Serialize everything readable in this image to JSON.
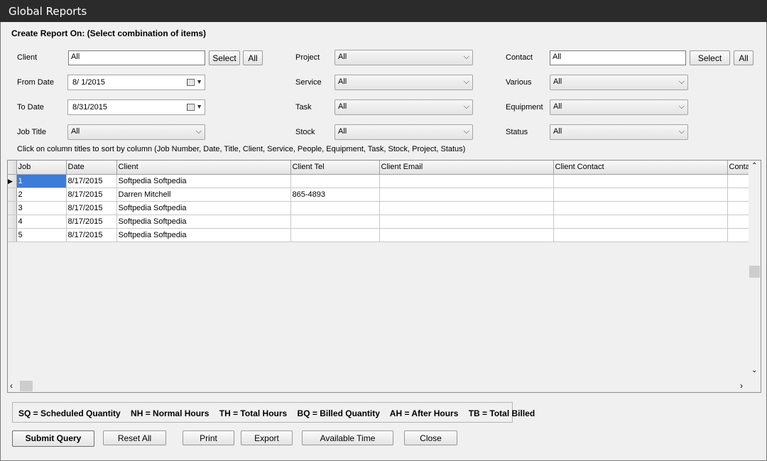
{
  "window": {
    "title": "Global Reports"
  },
  "heading": "Create Report On: (Select combination of items)",
  "filters": {
    "client": {
      "label": "Client",
      "value": "All",
      "select_label": "Select",
      "all_label": "All"
    },
    "from_date": {
      "label": "From Date",
      "value": "8/  1/2015"
    },
    "to_date": {
      "label": "To Date",
      "value": "8/31/2015"
    },
    "job_title": {
      "label": "Job Title",
      "value": "All"
    },
    "project": {
      "label": "Project",
      "value": "All"
    },
    "service": {
      "label": "Service",
      "value": "All"
    },
    "task": {
      "label": "Task",
      "value": "All"
    },
    "stock": {
      "label": "Stock",
      "value": "All"
    },
    "contact": {
      "label": "Contact",
      "value": "All",
      "select_label": "Select",
      "all_label": "All"
    },
    "various": {
      "label": "Various",
      "value": "All"
    },
    "equipment": {
      "label": "Equipment",
      "value": "All"
    },
    "status": {
      "label": "Status",
      "value": "All"
    }
  },
  "sort_hint": "Click on column titles to sort by column (Job Number, Date, Title, Client, Service, People, Equipment, Task, Stock, Project, Status)",
  "table": {
    "columns": [
      "Job",
      "Date",
      "Client",
      "Client Tel",
      "Client Email",
      "Client Contact",
      "Conta"
    ],
    "rows": [
      [
        "1",
        "8/17/2015",
        "Softpedia Softpedia",
        "",
        "",
        "",
        ""
      ],
      [
        "2",
        "8/17/2015",
        "Darren Mitchell",
        "865-4893",
        "",
        "",
        ""
      ],
      [
        "3",
        "8/17/2015",
        "Softpedia Softpedia",
        "",
        "",
        "",
        ""
      ],
      [
        "4",
        "8/17/2015",
        "Softpedia Softpedia",
        "",
        "",
        "",
        ""
      ],
      [
        "5",
        "8/17/2015",
        "Softpedia Softpedia",
        "",
        "",
        "",
        ""
      ]
    ]
  },
  "legend": [
    "SQ = Scheduled Quantity",
    "NH = Normal Hours",
    "TH = Total Hours",
    "BQ = Billed Quantity",
    "AH = After Hours",
    "TB = Total Billed"
  ],
  "buttons": {
    "submit": "Submit Query",
    "reset": "Reset All",
    "print": "Print",
    "export": "Export",
    "available_time": "Available Time",
    "close": "Close"
  },
  "icons": {
    "dropdown": "chevron-down-icon",
    "calendar": "calendar-icon"
  }
}
